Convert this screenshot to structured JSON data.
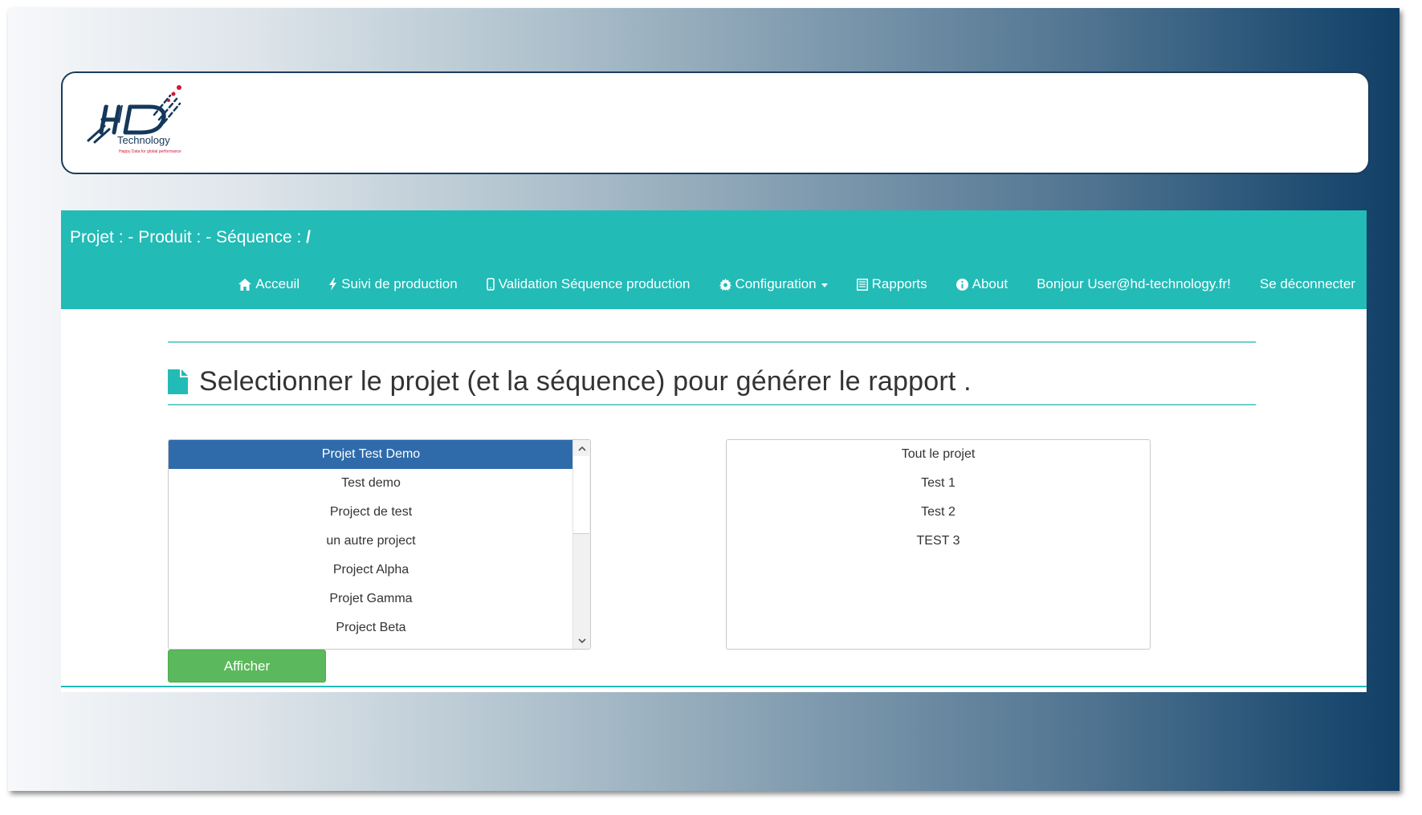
{
  "logo": {
    "brand": "HD",
    "name": "Technology",
    "tagline": "Happy Data for global performance"
  },
  "breadcrumb": {
    "text": "Projet : - Produit : - Séquence :",
    "separator": "/"
  },
  "nav": [
    {
      "label": "Acceuil",
      "icon": "home-icon"
    },
    {
      "label": "Suivi de production",
      "icon": "bolt-icon"
    },
    {
      "label": "Validation Séquence production",
      "icon": "mobile-icon"
    },
    {
      "label": "Configuration",
      "icon": "gear-icon",
      "dropdown": true
    },
    {
      "label": "Rapports",
      "icon": "list-alt-icon"
    },
    {
      "label": "About",
      "icon": "info-icon"
    },
    {
      "label": "Bonjour User@hd-technology.fr!"
    },
    {
      "label": "Se déconnecter"
    }
  ],
  "page": {
    "title": "Selectionner le projet (et la séquence) pour générer le rapport ."
  },
  "projects": {
    "selected_index": 0,
    "items": [
      "Projet Test Demo",
      "Test demo",
      "Project de test",
      "un autre project",
      "Project Alpha",
      "Projet Gamma",
      "Project Beta"
    ]
  },
  "sequences": {
    "items": [
      "Tout le projet",
      "Test 1",
      "Test 2",
      "TEST 3"
    ]
  },
  "actions": {
    "show_label": "Afficher"
  },
  "colors": {
    "teal": "#22bbb6",
    "selected": "#2f6bab",
    "button": "#5cb85c",
    "logo_navy": "#14385a",
    "logo_red": "#d0173c"
  }
}
